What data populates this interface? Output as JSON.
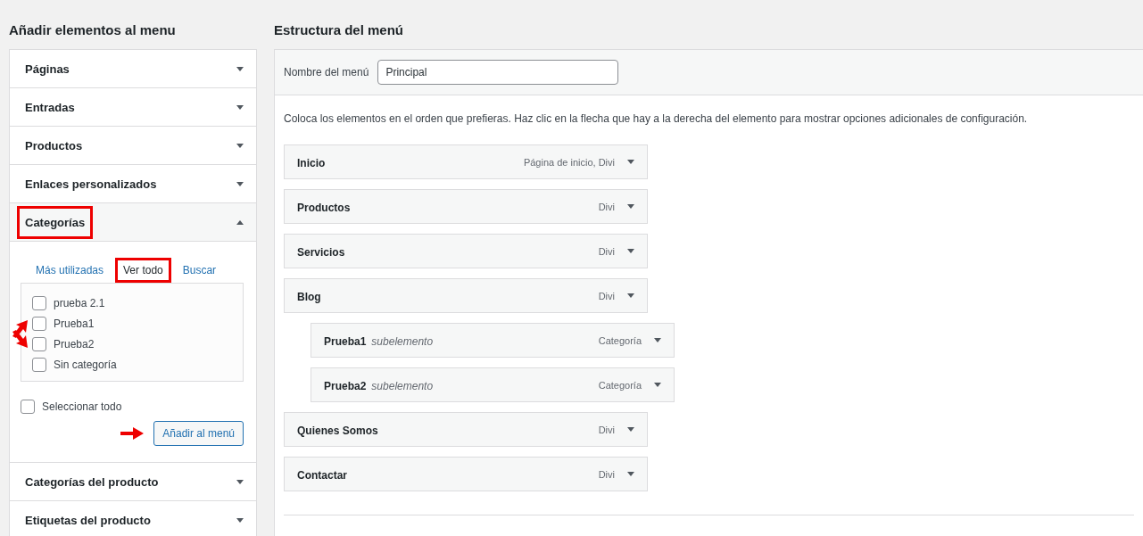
{
  "left": {
    "title": "Añadir elementos al menu",
    "sections": [
      {
        "label": "Páginas",
        "expanded": false,
        "highlighted": false
      },
      {
        "label": "Entradas",
        "expanded": false,
        "highlighted": false
      },
      {
        "label": "Productos",
        "expanded": false,
        "highlighted": false
      },
      {
        "label": "Enlaces personalizados",
        "expanded": false,
        "highlighted": false
      },
      {
        "label": "Categorías",
        "expanded": true,
        "highlighted": true,
        "tabs": [
          {
            "label": "Más utilizadas",
            "selected": false,
            "highlighted": false
          },
          {
            "label": "Ver todo",
            "selected": true,
            "highlighted": true
          },
          {
            "label": "Buscar",
            "selected": false,
            "highlighted": false
          }
        ],
        "items": [
          {
            "label": "prueba 2.1",
            "checked": false,
            "arrow": false
          },
          {
            "label": "Prueba1",
            "checked": false,
            "arrow": true
          },
          {
            "label": "Prueba2",
            "checked": false,
            "arrow": true
          },
          {
            "label": "Sin categoría",
            "checked": false,
            "arrow": false
          }
        ],
        "select_all": {
          "label": "Seleccionar todo",
          "checked": false
        },
        "button": {
          "label": "Añadir al menú",
          "arrow": true
        }
      },
      {
        "label": "Categorías del producto",
        "expanded": false,
        "highlighted": false
      },
      {
        "label": "Etiquetas del producto",
        "expanded": false,
        "highlighted": false
      }
    ]
  },
  "right": {
    "title": "Estructura del menú",
    "name_label": "Nombre del menú",
    "name_value": "Principal",
    "hint": "Coloca los elementos en el orden que prefieras. Haz clic en la flecha que hay a la derecha del elemento para mostrar opciones adicionales de configuración.",
    "menu_items": [
      {
        "title": "Inicio",
        "type": "Página de inicio, Divi"
      },
      {
        "title": "Productos",
        "type": "Divi"
      },
      {
        "title": "Servicios",
        "type": "Divi"
      },
      {
        "title": "Blog",
        "type": "Divi",
        "children": [
          {
            "title": "Prueba1",
            "note": "subelemento",
            "type": "Categoría"
          },
          {
            "title": "Prueba2",
            "note": "subelemento",
            "type": "Categoría"
          }
        ]
      },
      {
        "title": "Quienes Somos",
        "type": "Divi"
      },
      {
        "title": "Contactar",
        "type": "Divi"
      }
    ]
  }
}
